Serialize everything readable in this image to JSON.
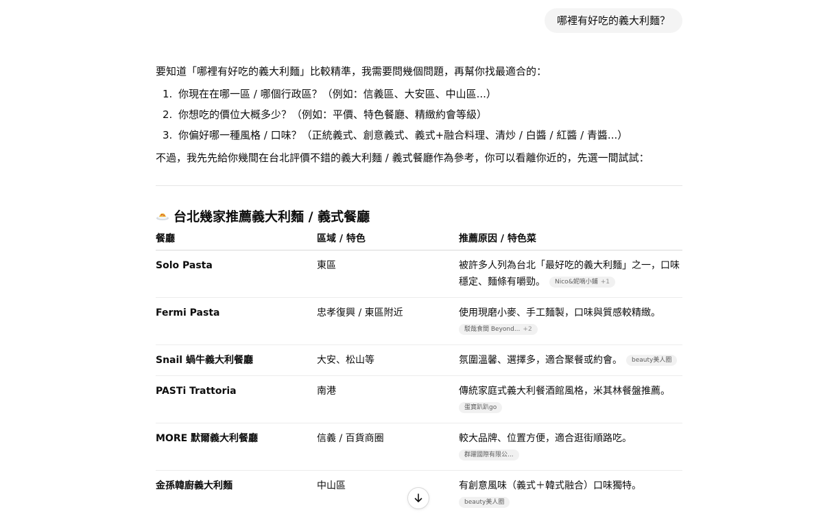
{
  "user_message": "哪裡有好吃的義大利麵？",
  "answer": {
    "intro": "要知道「哪裡有好吃的義大利麵」比較精準，我需要問幾個問題，再幫你找最適合的：",
    "questions": [
      {
        "num": "1.",
        "text": "你現在在哪一區 / 哪個行政區？（例如：信義區、大安區、中山區...）"
      },
      {
        "num": "2.",
        "text": "你想吃的價位大概多少？（例如：平價、特色餐廳、精緻約會等級）"
      },
      {
        "num": "3.",
        "text": "你偏好哪一種風格 / 口味？（正統義式、創意義式、義式+融合料理、清炒 / 白醬 / 紅醬 / 青醬...）"
      }
    ],
    "outro": "不過，我先先給你幾間在台北評價不錯的義大利麵 / 義式餐廳作為參考，你可以看離你近的，先選一間試試："
  },
  "section": {
    "icon": "pasta-dish-icon",
    "title": "台北幾家推薦義大利麵 / 義式餐廳"
  },
  "table": {
    "headers": [
      "餐廳",
      "區域 / 特色",
      "推薦原因 / 特色菜"
    ],
    "rows": [
      {
        "name": "Solo Pasta",
        "area": "東區",
        "reason": "被許多人列為台北「最好吃的義大利麵」之一，口味穩定、麵條有嚼勁。",
        "cite": "Nico&妮嘀小鋪",
        "cite_more": "+1"
      },
      {
        "name": "Fermi Pasta",
        "area": "忠孝復興 / 東區附近",
        "reason": "使用現磨小麥、手工麵製，口味與質感較精緻。",
        "cite": "駁哉食間 Beyond...",
        "cite_more": "+2"
      },
      {
        "name": "Snail 蝸牛義大利餐廳",
        "area": "大安、松山等",
        "reason": "氛圍溫馨、選擇多，適合聚餐或約會。",
        "cite": "beauty美人圈",
        "cite_more": ""
      },
      {
        "name": "PASTi Trattoria",
        "area": "南港",
        "reason": "傳統家庭式義大利餐酒館風格，米其林餐盤推薦。",
        "cite": "蛋寶趴趴go",
        "cite_more": ""
      },
      {
        "name": "MORE 默爾義大利餐廳",
        "area": "信義 / 百貨商圈",
        "reason": "較大品牌、位置方便，適合逛街順路吃。",
        "cite": "群躍國際有限公...",
        "cite_more": ""
      },
      {
        "name": "金孫韓廚義大利麵",
        "area": "中山區",
        "reason": "有創意風味（義式＋韓式融合）口味獨特。",
        "cite": "beauty美人圈",
        "cite_more": ""
      }
    ]
  },
  "scroll_button": {
    "icon": "arrow-down-icon"
  },
  "colors": {
    "text": "#0d0d0d",
    "bubble_bg": "#f4f4f4",
    "cite_bg": "#f1f1f1",
    "cite_text": "#5d5d5d",
    "border": "#e5e5e5"
  }
}
